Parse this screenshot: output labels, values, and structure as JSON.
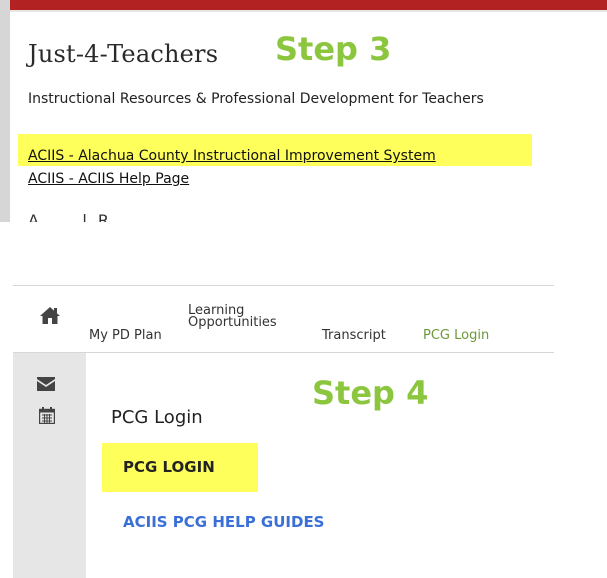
{
  "step3": {
    "step_label": "Step 3",
    "site_title": "Just-4-Teachers",
    "subtitle": "Instructional Resources & Professional Development for Teachers",
    "links": [
      "ACIIS - Alachua County Instructional Improvement System",
      "ACIIS - ACIIS Help Page"
    ],
    "clipped_text": "A ... l R"
  },
  "step4": {
    "step_label": "Step 4",
    "nav": {
      "home_icon": "home-icon",
      "my_pd_plan": "My PD Plan",
      "learning_line1": "Learning",
      "learning_line2": "Opportunities",
      "transcript": "Transcript",
      "pcg_login": "PCG Login"
    },
    "sidebar_icons": [
      "envelope-icon",
      "calendar-icon"
    ],
    "panel_heading": "PCG Login",
    "login_button": "PCG LOGIN",
    "help_link": "ACIIS PCG HELP GUIDES"
  },
  "colors": {
    "accent_red": "#b22222",
    "step_green": "#8cc63f",
    "highlight_yellow": "#ffff5c",
    "link_blue": "#3a6fd8",
    "active_nav_green": "#6a9a3a"
  }
}
